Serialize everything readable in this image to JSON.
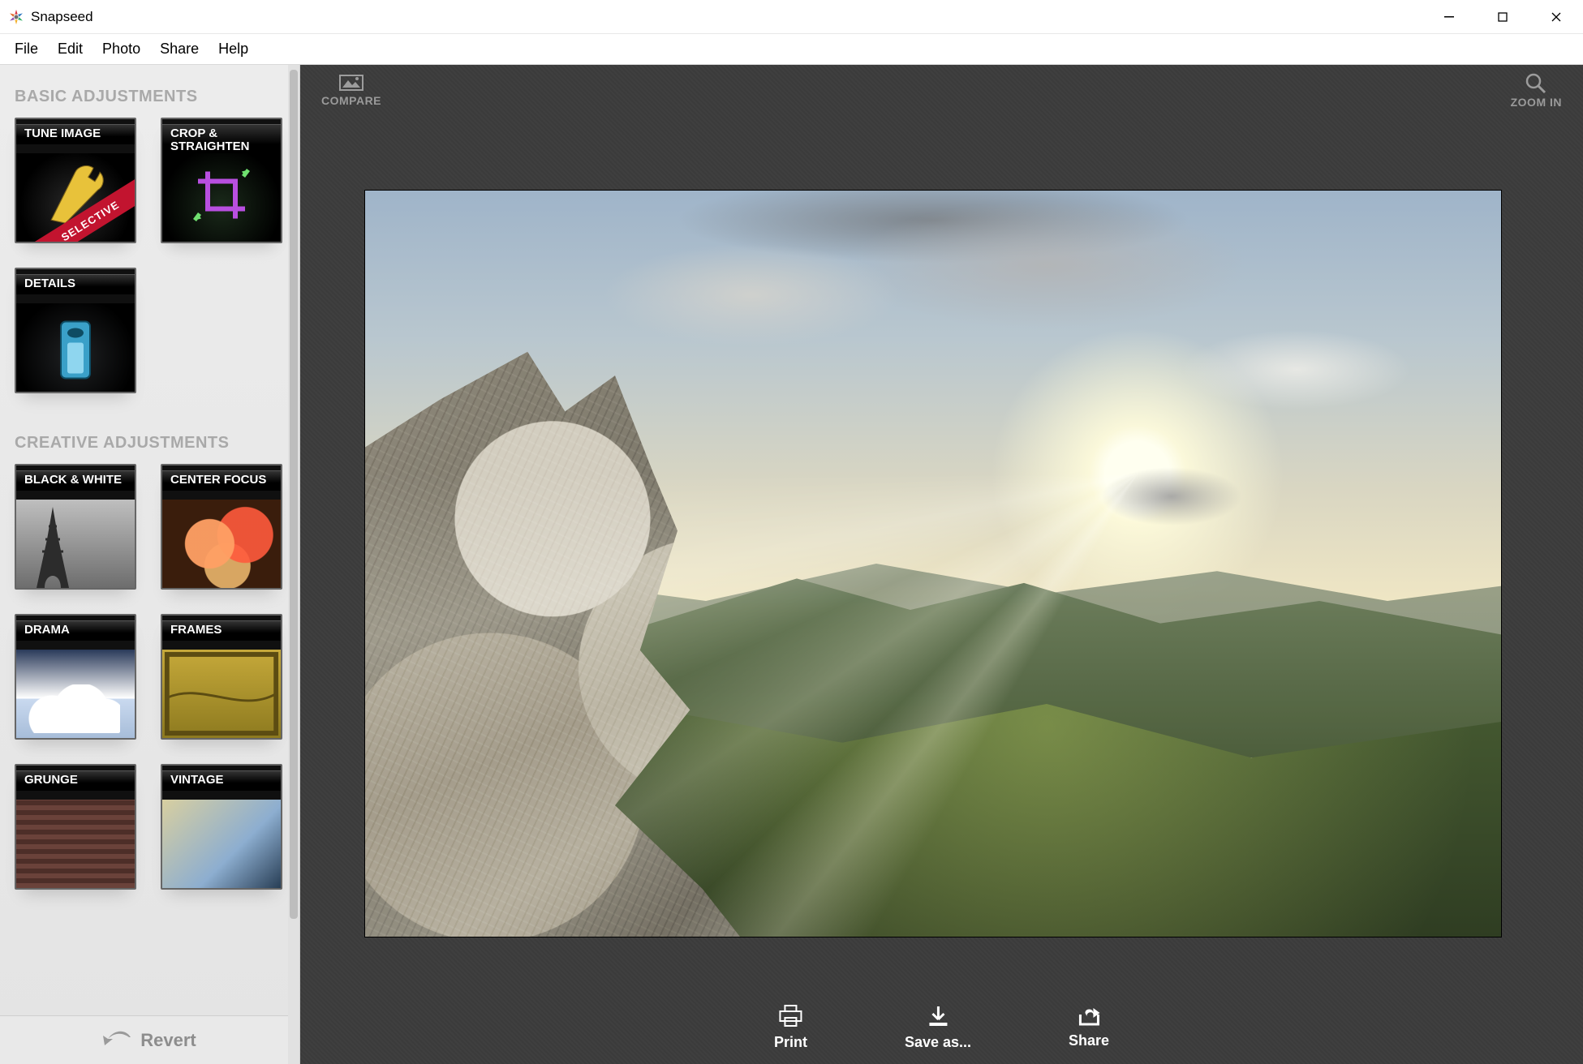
{
  "window": {
    "title": "Snapseed"
  },
  "menu": {
    "items": [
      "File",
      "Edit",
      "Photo",
      "Share",
      "Help"
    ]
  },
  "sidebar": {
    "sections": {
      "basic": {
        "title": "BASIC ADJUSTMENTS",
        "tools": [
          {
            "id": "tune-image",
            "label": "TUNE IMAGE",
            "badge": "SELECTIVE"
          },
          {
            "id": "crop-straighten",
            "label": "CROP & STRAIGHTEN"
          },
          {
            "id": "details",
            "label": "DETAILS"
          }
        ]
      },
      "creative": {
        "title": "CREATIVE ADJUSTMENTS",
        "tools": [
          {
            "id": "black-white",
            "label": "BLACK & WHITE"
          },
          {
            "id": "center-focus",
            "label": "CENTER FOCUS"
          },
          {
            "id": "drama",
            "label": "DRAMA"
          },
          {
            "id": "frames",
            "label": "FRAMES"
          },
          {
            "id": "grunge",
            "label": "GRUNGE"
          },
          {
            "id": "vintage",
            "label": "VINTAGE"
          }
        ]
      }
    },
    "revert_label": "Revert"
  },
  "canvas": {
    "top_left": {
      "label": "COMPARE"
    },
    "top_right": {
      "label": "ZOOM IN"
    },
    "bottom_actions": {
      "print": "Print",
      "save_as": "Save as...",
      "share": "Share"
    }
  }
}
